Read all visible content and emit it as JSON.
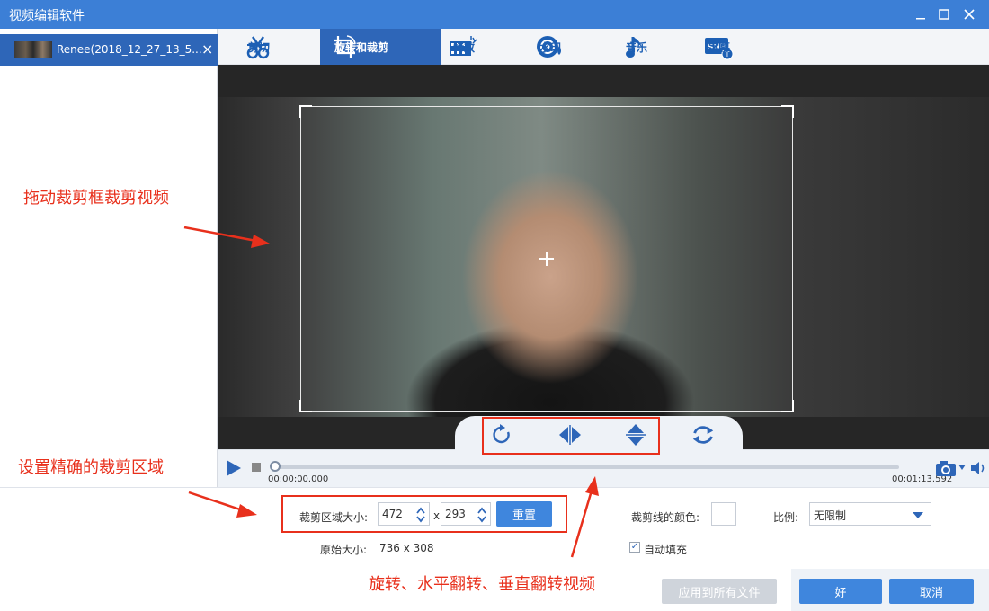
{
  "window": {
    "title": "视频编辑软件",
    "controls": [
      "minimize",
      "maximize",
      "close"
    ]
  },
  "file_tab": {
    "name": "Renee(2018_12_27_13_5...",
    "close": "×"
  },
  "tabs": [
    {
      "id": "cut",
      "label": "剪切",
      "icon": "scissors-icon"
    },
    {
      "id": "rotate",
      "label": "旋转和裁剪",
      "icon": "crop-icon",
      "active": true
    },
    {
      "id": "effects",
      "label": "特效",
      "icon": "effects-icon"
    },
    {
      "id": "watermark",
      "label": "水印",
      "icon": "watermark-icon"
    },
    {
      "id": "music",
      "label": "音乐",
      "icon": "music-note-icon"
    },
    {
      "id": "subtitle",
      "label": "字幕",
      "icon": "subtitle-icon"
    }
  ],
  "player": {
    "current_time": "00:00:00.000",
    "total_time": "00:01:13.592",
    "progress": 0
  },
  "crop": {
    "area_label": "裁剪区域大小:",
    "width": "472",
    "separator": "x",
    "height": "293",
    "reset_label": "重置",
    "original_label": "原始大小:",
    "original_value": "736 x 308",
    "line_color_label": "裁剪线的颜色:",
    "ratio_label": "比例:",
    "ratio_value": "无限制",
    "autofill_label": "自动填充",
    "autofill_checked": true
  },
  "actions": {
    "apply_all": "应用到所有文件",
    "ok": "好",
    "cancel": "取消"
  },
  "annotations": {
    "drag_crop": "拖动裁剪框裁剪视频",
    "set_precise": "设置精确的裁剪区域",
    "rotate_flip": "旋转、水平翻转、垂直翻转视频"
  },
  "colors": {
    "accent": "#2e66b8",
    "titlebar": "#3c7fd6",
    "annotation": "#e8301c"
  }
}
